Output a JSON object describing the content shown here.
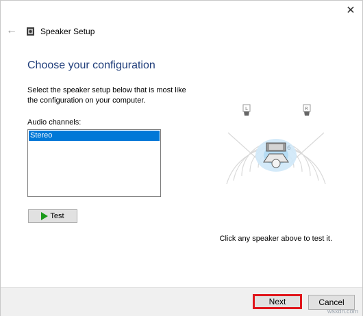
{
  "window": {
    "close_glyph": "✕"
  },
  "nav": {
    "back_glyph": "←"
  },
  "titlebar": {
    "title": "Speaker Setup",
    "icon": "speaker-icon"
  },
  "main": {
    "heading": "Choose your configuration",
    "description": "Select the speaker setup below that is most like the configuration on your computer.",
    "audio_channels_label": "Audio channels:",
    "audio_channels": [
      "Stereo"
    ],
    "selected_channel": "Stereo",
    "test_label": "Test",
    "hint": "Click any speaker above to test it."
  },
  "diagram": {
    "left_label": "L",
    "right_label": "R"
  },
  "footer": {
    "next_label": "Next",
    "cancel_label": "Cancel"
  },
  "watermark": "wsxdn.com",
  "colors": {
    "heading": "#1f3d7a",
    "selection": "#0078d7",
    "highlight": "#e0151b"
  }
}
